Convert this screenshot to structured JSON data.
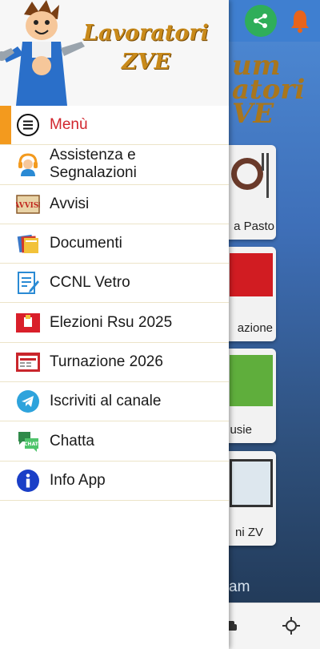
{
  "background": {
    "title_lines": [
      "um",
      "atori",
      "VE"
    ],
    "cards": [
      {
        "label": "a Pasto"
      },
      {
        "label": "azione"
      },
      {
        "label": "usie"
      },
      {
        "label": "ni ZV"
      }
    ],
    "bottom_text": "am"
  },
  "drawer": {
    "header": {
      "title_line1": "Lavoratori",
      "title_line2": "ZVE"
    },
    "items": [
      {
        "label": "Menù",
        "icon": "hamburger-circle-icon",
        "active": true
      },
      {
        "label": "Assistenza e Segnalazioni",
        "icon": "headset-support-icon"
      },
      {
        "label": "Avvisi",
        "icon": "avvisi-sign-icon"
      },
      {
        "label": "Documenti",
        "icon": "folders-icon"
      },
      {
        "label": "CCNL Vetro",
        "icon": "document-edit-icon"
      },
      {
        "label": "Elezioni Rsu 2025",
        "icon": "ballot-box-icon"
      },
      {
        "label": "Turnazione 2026",
        "icon": "calendar-board-icon"
      },
      {
        "label": "Iscriviti al canale",
        "icon": "telegram-icon"
      },
      {
        "label": "Chatta",
        "icon": "live-chat-icon"
      },
      {
        "label": "Info App",
        "icon": "info-icon"
      }
    ]
  },
  "colors": {
    "active_label": "#d1252d",
    "active_marker": "#f39a1e",
    "header_title": "#c98a1a",
    "divider": "#ece4c8"
  }
}
